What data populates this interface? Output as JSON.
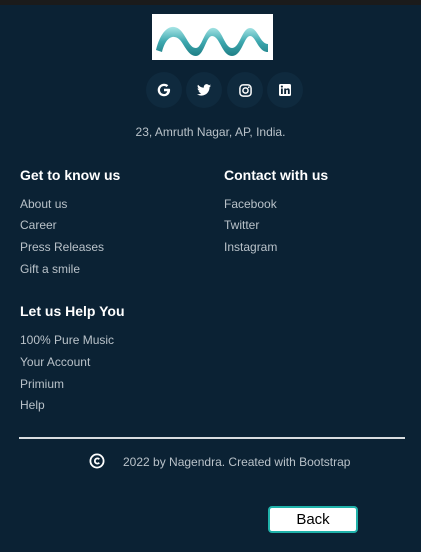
{
  "logo": {
    "name": "logo-mw"
  },
  "social": [
    {
      "icon": "google-icon"
    },
    {
      "icon": "twitter-icon"
    },
    {
      "icon": "instagram-icon"
    },
    {
      "icon": "linkedin-icon"
    }
  ],
  "address": "23, Amruth Nagar, AP, India.",
  "sections": {
    "know": {
      "title": "Get to know us",
      "links": [
        "About us",
        "Career",
        "Press Releases",
        "Gift a smile"
      ]
    },
    "contact": {
      "title": "Contact with us",
      "links": [
        "Facebook",
        "Twitter",
        "Instagram"
      ]
    },
    "help": {
      "title": "Let us Help You",
      "links": [
        "100% Pure Music",
        "Your Account",
        "Primium",
        "Help"
      ]
    }
  },
  "footer": {
    "copyright": "2022 by Nagendra. Created with Bootstrap"
  },
  "back_button": "Back",
  "colors": {
    "background": "#0b2234",
    "accent": "#20b2aa"
  }
}
